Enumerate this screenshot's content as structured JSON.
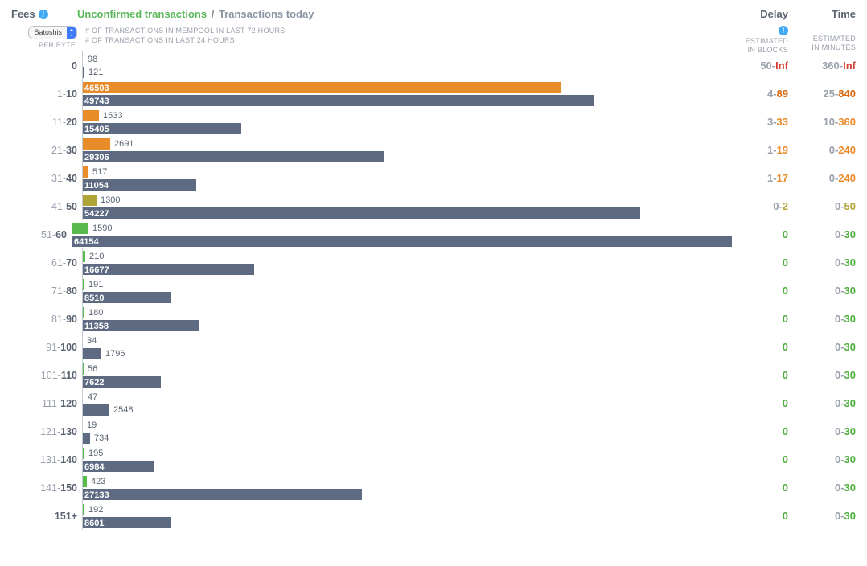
{
  "header": {
    "fees_label": "Fees",
    "title_left": "Unconfirmed transactions",
    "title_sep": "/",
    "title_right": "Transactions today",
    "delay_label": "Delay",
    "time_label": "Time"
  },
  "subheader": {
    "unit_select": "Satoshis",
    "per_byte": "PER BYTE",
    "legend_72h": "# OF TRANSACTIONS IN MEMPOOL IN LAST 72 HOURS",
    "legend_24h": "# OF TRANSACTIONS IN LAST 24 HOURS",
    "delay_sub1": "ESTIMATED",
    "delay_sub2": "IN BLOCKS",
    "time_sub1": "ESTIMATED",
    "time_sub2": "IN MINUTES"
  },
  "chart_data": {
    "type": "bar",
    "title": "Unconfirmed transactions / Transactions today",
    "xlabel": "# of transactions",
    "ylabel": "Fees (Satoshis per byte)",
    "series": [
      {
        "name": "transactions in mempool last 72h",
        "values": [
          98,
          46503,
          1533,
          2691,
          517,
          1300,
          1590,
          210,
          191,
          180,
          34,
          56,
          47,
          19,
          195,
          423,
          192
        ]
      },
      {
        "name": "transactions last 24h",
        "values": [
          121,
          49743,
          15405,
          29306,
          11054,
          54227,
          64154,
          16677,
          8510,
          11358,
          1796,
          7622,
          2548,
          734,
          6984,
          27133,
          8601
        ]
      }
    ],
    "categories": [
      "0",
      "1-10",
      "11-20",
      "21-30",
      "31-40",
      "41-50",
      "51-60",
      "61-70",
      "71-80",
      "81-90",
      "91-100",
      "101-110",
      "111-120",
      "121-130",
      "131-140",
      "141-150",
      "151+"
    ],
    "max_value_for_scale": 64154
  },
  "rows": [
    {
      "label_low": "",
      "label_hi": "0",
      "v72": 98,
      "v24": 121,
      "top_color": "c-none",
      "delay_low": "50",
      "delay_hi": "Inf",
      "delay_class": "h-inf",
      "time_low": "360",
      "time_hi": "Inf",
      "time_class": "h-inf"
    },
    {
      "label_low": "1-",
      "label_hi": "10",
      "v72": 46503,
      "v24": 49743,
      "top_color": "",
      "delay_low": "4",
      "delay_hi": "89",
      "delay_class": "h-darkor",
      "time_low": "25",
      "time_hi": "840",
      "time_class": "h-darkor"
    },
    {
      "label_low": "11-",
      "label_hi": "20",
      "v72": 1533,
      "v24": 15405,
      "top_color": "",
      "delay_low": "3",
      "delay_hi": "33",
      "delay_class": "h-orange",
      "time_low": "10",
      "time_hi": "360",
      "time_class": "h-orange"
    },
    {
      "label_low": "21-",
      "label_hi": "30",
      "v72": 2691,
      "v24": 29306,
      "top_color": "",
      "delay_low": "1",
      "delay_hi": "19",
      "delay_class": "h-orange",
      "time_low": "0",
      "time_hi": "240",
      "time_class": "h-orange"
    },
    {
      "label_low": "31-",
      "label_hi": "40",
      "v72": 517,
      "v24": 11054,
      "top_color": "",
      "delay_low": "1",
      "delay_hi": "17",
      "delay_class": "h-orange",
      "time_low": "0",
      "time_hi": "240",
      "time_class": "h-orange"
    },
    {
      "label_low": "41-",
      "label_hi": "50",
      "v72": 1300,
      "v24": 54227,
      "top_color": "c-olive",
      "delay_low": "0",
      "delay_hi": "2",
      "delay_class": "h-olive",
      "time_low": "0",
      "time_hi": "50",
      "time_class": "h-olive"
    },
    {
      "label_low": "51-",
      "label_hi": "60",
      "v72": 1590,
      "v24": 64154,
      "top_color": "c-green",
      "delay_low": "",
      "delay_hi": "0",
      "delay_class": "h-green",
      "time_low": "0",
      "time_hi": "30",
      "time_class": "h-green"
    },
    {
      "label_low": "61-",
      "label_hi": "70",
      "v72": 210,
      "v24": 16677,
      "top_color": "c-green",
      "delay_low": "",
      "delay_hi": "0",
      "delay_class": "h-green",
      "time_low": "0",
      "time_hi": "30",
      "time_class": "h-green"
    },
    {
      "label_low": "71-",
      "label_hi": "80",
      "v72": 191,
      "v24": 8510,
      "top_color": "c-green",
      "delay_low": "",
      "delay_hi": "0",
      "delay_class": "h-green",
      "time_low": "0",
      "time_hi": "30",
      "time_class": "h-green"
    },
    {
      "label_low": "81-",
      "label_hi": "90",
      "v72": 180,
      "v24": 11358,
      "top_color": "c-green",
      "delay_low": "",
      "delay_hi": "0",
      "delay_class": "h-green",
      "time_low": "0",
      "time_hi": "30",
      "time_class": "h-green"
    },
    {
      "label_low": "91-",
      "label_hi": "100",
      "v72": 34,
      "v24": 1796,
      "top_color": "c-none",
      "delay_low": "",
      "delay_hi": "0",
      "delay_class": "h-green",
      "time_low": "0",
      "time_hi": "30",
      "time_class": "h-green"
    },
    {
      "label_low": "101-",
      "label_hi": "110",
      "v72": 56,
      "v24": 7622,
      "top_color": "c-green",
      "delay_low": "",
      "delay_hi": "0",
      "delay_class": "h-green",
      "time_low": "0",
      "time_hi": "30",
      "time_class": "h-green"
    },
    {
      "label_low": "111-",
      "label_hi": "120",
      "v72": 47,
      "v24": 2548,
      "top_color": "c-none",
      "delay_low": "",
      "delay_hi": "0",
      "delay_class": "h-green",
      "time_low": "0",
      "time_hi": "30",
      "time_class": "h-green"
    },
    {
      "label_low": "121-",
      "label_hi": "130",
      "v72": 19,
      "v24": 734,
      "top_color": "c-none",
      "delay_low": "",
      "delay_hi": "0",
      "delay_class": "h-green",
      "time_low": "0",
      "time_hi": "30",
      "time_class": "h-green"
    },
    {
      "label_low": "131-",
      "label_hi": "140",
      "v72": 195,
      "v24": 6984,
      "top_color": "c-green",
      "delay_low": "",
      "delay_hi": "0",
      "delay_class": "h-green",
      "time_low": "0",
      "time_hi": "30",
      "time_class": "h-green"
    },
    {
      "label_low": "141-",
      "label_hi": "150",
      "v72": 423,
      "v24": 27133,
      "top_color": "c-green",
      "delay_low": "",
      "delay_hi": "0",
      "delay_class": "h-green",
      "time_low": "0",
      "time_hi": "30",
      "time_class": "h-green"
    },
    {
      "label_low": "",
      "label_hi": "151+",
      "v72": 192,
      "v24": 8601,
      "top_color": "c-green",
      "delay_low": "",
      "delay_hi": "0",
      "delay_class": "h-green",
      "time_low": "0",
      "time_hi": "30",
      "time_class": "h-green"
    }
  ]
}
